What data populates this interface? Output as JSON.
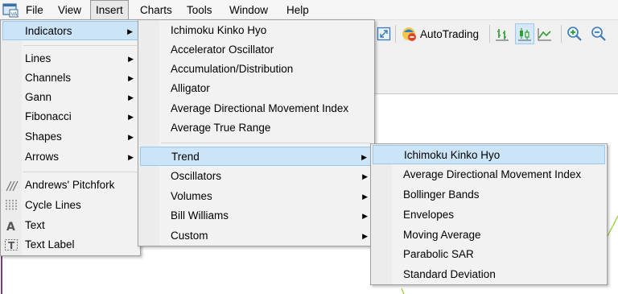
{
  "menubar": {
    "items": [
      "File",
      "View",
      "Insert",
      "Charts",
      "Tools",
      "Window",
      "Help"
    ],
    "active": "Insert"
  },
  "toolbar": {
    "autotrading_label": "AutoTrading",
    "icons": [
      "fit-window-icon",
      "autotrading-icon",
      "bar-chart-icon",
      "candlestick-chart-icon",
      "line-chart-icon",
      "zoom-in-icon",
      "zoom-out-icon"
    ]
  },
  "insert_menu": {
    "items": [
      {
        "label": "Indicators",
        "submenu": true,
        "highlighted": true
      },
      {
        "label": "Lines",
        "submenu": true
      },
      {
        "label": "Channels",
        "submenu": true
      },
      {
        "label": "Gann",
        "submenu": true
      },
      {
        "label": "Fibonacci",
        "submenu": true
      },
      {
        "label": "Shapes",
        "submenu": true
      },
      {
        "label": "Arrows",
        "submenu": true
      },
      {
        "label": "Andrews' Pitchfork",
        "icon": "pitchfork-icon"
      },
      {
        "label": "Cycle Lines",
        "icon": "cycle-lines-icon"
      },
      {
        "label": "Text",
        "icon": "text-icon"
      },
      {
        "label": "Text Label",
        "icon": "text-label-icon"
      }
    ]
  },
  "indicators_menu": {
    "items": [
      {
        "label": "Ichimoku Kinko Hyo"
      },
      {
        "label": "Accelerator Oscillator"
      },
      {
        "label": "Accumulation/Distribution"
      },
      {
        "label": "Alligator"
      },
      {
        "label": "Average Directional Movement Index"
      },
      {
        "label": "Average True Range"
      },
      {
        "label": "Trend",
        "submenu": true,
        "highlighted": true
      },
      {
        "label": "Oscillators",
        "submenu": true
      },
      {
        "label": "Volumes",
        "submenu": true
      },
      {
        "label": "Bill Williams",
        "submenu": true
      },
      {
        "label": "Custom",
        "submenu": true
      }
    ]
  },
  "trend_menu": {
    "items": [
      {
        "label": "Ichimoku Kinko Hyo",
        "highlighted": true
      },
      {
        "label": "Average Directional Movement Index"
      },
      {
        "label": "Bollinger Bands"
      },
      {
        "label": "Envelopes"
      },
      {
        "label": "Moving Average"
      },
      {
        "label": "Parabolic SAR"
      },
      {
        "label": "Standard Deviation"
      }
    ]
  },
  "colors": {
    "highlight_bg": "#cce4f7",
    "highlight_border": "#99c9ef",
    "chart_line": "#9acd32",
    "accent_green": "#2e9e2e"
  }
}
